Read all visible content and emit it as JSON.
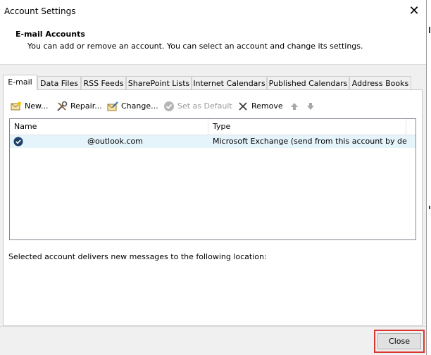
{
  "window": {
    "title": "Account Settings"
  },
  "header": {
    "title": "E-mail Accounts",
    "description": "You can add or remove an account. You can select an account and change its settings."
  },
  "tabs": [
    {
      "label": "E-mail",
      "active": true
    },
    {
      "label": "Data Files"
    },
    {
      "label": "RSS Feeds"
    },
    {
      "label": "SharePoint Lists"
    },
    {
      "label": "Internet Calendars"
    },
    {
      "label": "Published Calendars"
    },
    {
      "label": "Address Books"
    }
  ],
  "toolbar": {
    "new_label": "New...",
    "repair_label": "Repair...",
    "change_label": "Change...",
    "default_label": "Set as Default",
    "remove_label": "Remove"
  },
  "accounts_table": {
    "columns": [
      "Name",
      "Type"
    ],
    "rows": [
      {
        "name": "@outlook.com",
        "type": "Microsoft Exchange (send from this account by def..."
      }
    ]
  },
  "delivery_text": "Selected account delivers new messages to the following location:",
  "footer": {
    "close_label": "Close"
  },
  "colors": {
    "highlight_border": "#d9362f",
    "row_selected": "#e5f3fb",
    "default_badge": "#1e3f66"
  }
}
